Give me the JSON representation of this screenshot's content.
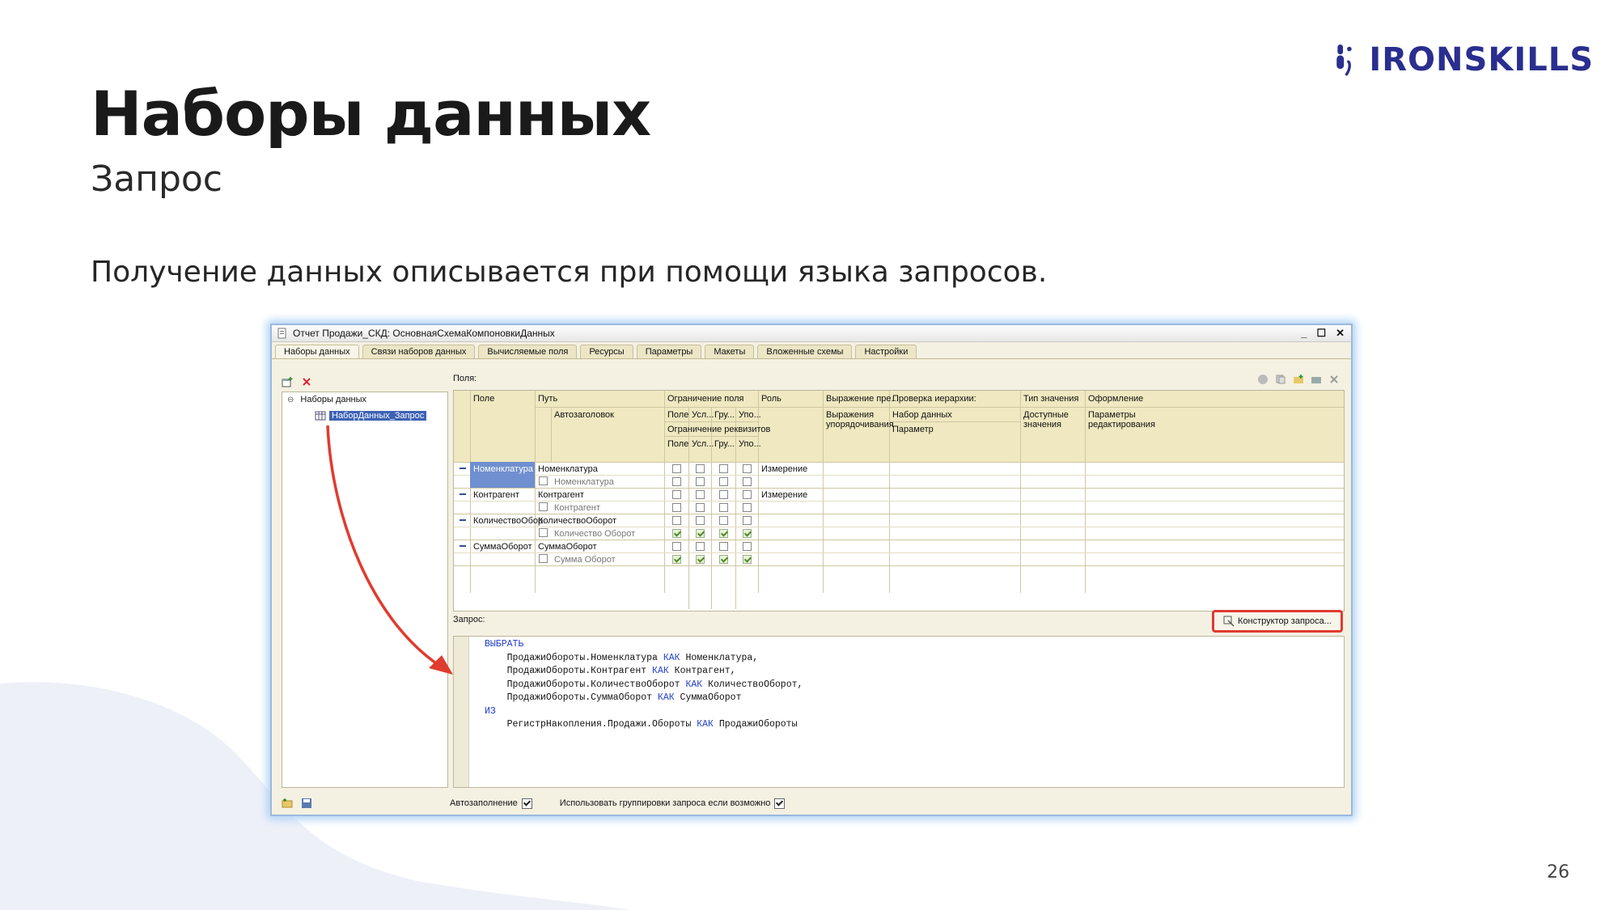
{
  "slide": {
    "title": "Наборы данных",
    "subtitle": "Запрос",
    "lead": "Получение данных описывается при помощи языка запросов.",
    "page_number": "26",
    "brand": "IRONSKILLS",
    "brand_color": "#2a2e8f"
  },
  "window": {
    "title": "Отчет Продажи_СКД: ОсновнаяСхемаКомпоновкиДанных",
    "controls": [
      "_",
      "☐",
      "✕"
    ],
    "tabs": [
      "Наборы данных",
      "Связи наборов данных",
      "Вычисляемые поля",
      "Ресурсы",
      "Параметры",
      "Макеты",
      "Вложенные схемы",
      "Настройки"
    ],
    "tree": {
      "root": "Наборы данных",
      "child": "НаборДанных_Запрос"
    },
    "fields_label": "Поля:",
    "headers": {
      "field": "Поле",
      "path": "Путь",
      "autotitle": "Автозаголовок",
      "field_restriction": "Ограничение поля",
      "attr_restriction": "Ограничение реквизитов",
      "sub": [
        "Поле",
        "Усл...",
        "Гру...",
        "Упо..."
      ],
      "role": "Роль",
      "expr_pre": "Выражение пре...",
      "order_expr": "Выражения упорядочивания",
      "hier_check": "Проверка иерархии:",
      "dataset": "Набор данных",
      "param": "Параметр",
      "value_type": "Тип значения",
      "avail_values": "Доступные значения",
      "appearance": "Оформление",
      "edit_params": "Параметры редактирования"
    },
    "rows": [
      {
        "field": "Номенклатура",
        "path": "Номенклатура",
        "title": "Номенклатура",
        "role": "Измерение"
      },
      {
        "field": "Контрагент",
        "path": "Контрагент",
        "title": "Контрагент",
        "role": "Измерение"
      },
      {
        "field": "КоличествоОбор",
        "path": "КоличествоОборот",
        "title": "Количество Оборот",
        "role": ""
      },
      {
        "field": "СуммаОборот",
        "path": "СуммаОборот",
        "title": "Сумма Оборот",
        "role": ""
      }
    ],
    "query_label": "Запрос:",
    "query_button": "Конструктор запроса...",
    "query_lines": [
      {
        "kw": "ВЫБРАТЬ",
        "text": ""
      },
      {
        "kw": "",
        "text": "    ПродажиОбороты.Номенклатура ",
        "kw2": "КАК",
        "tail": " Номенклатура,"
      },
      {
        "kw": "",
        "text": "    ПродажиОбороты.Контрагент ",
        "kw2": "КАК",
        "tail": " Контрагент,"
      },
      {
        "kw": "",
        "text": "    ПродажиОбороты.КоличествоОборот ",
        "kw2": "КАК",
        "tail": " КоличествоОборот,"
      },
      {
        "kw": "",
        "text": "    ПродажиОбороты.СуммаОборот ",
        "kw2": "КАК",
        "tail": " СуммаОборот"
      },
      {
        "kw": "ИЗ",
        "text": ""
      },
      {
        "kw": "",
        "text": "    РегистрНакопления.Продажи.Обороты ",
        "kw2": "КАК",
        "tail": " ПродажиОбороты"
      }
    ],
    "autofill_label": "Автозаполнение",
    "use_grouping_label": "Использовать группировки запроса если возможно",
    "accent_red": "#e03b2f"
  }
}
